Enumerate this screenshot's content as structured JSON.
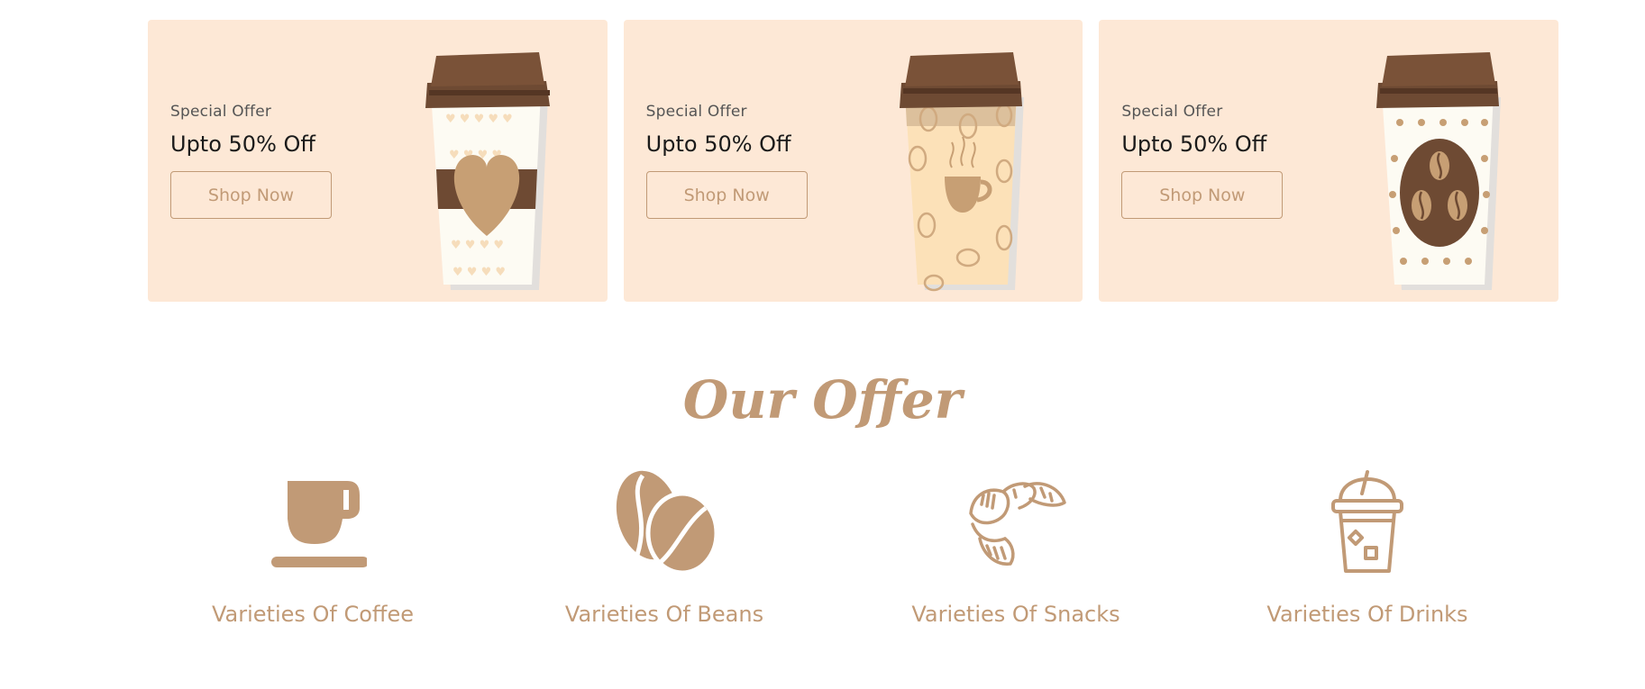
{
  "promos": [
    {
      "eyebrow": "Special Offer",
      "title": "Upto 50% Off",
      "button": "Shop Now",
      "cup_icon": "heart-cup-icon"
    },
    {
      "eyebrow": "Special Offer",
      "title": "Upto 50% Off",
      "button": "Shop Now",
      "cup_icon": "beans-cup-icon"
    },
    {
      "eyebrow": "Special Offer",
      "title": "Upto 50% Off",
      "button": "Shop Now",
      "cup_icon": "dots-cup-icon"
    }
  ],
  "offer": {
    "title": "Our Offer",
    "items": [
      {
        "label": "Varieties Of Coffee",
        "icon": "coffee-cup-icon"
      },
      {
        "label": "Varieties Of Beans",
        "icon": "coffee-bean-icon"
      },
      {
        "label": "Varieties Of Snacks",
        "icon": "croissant-icon"
      },
      {
        "label": "Varieties Of Drinks",
        "icon": "iced-drink-icon"
      }
    ]
  },
  "colors": {
    "accent": "#c19a76",
    "card_background": "#fde8d6",
    "cup_lid": "#6e4a33"
  }
}
